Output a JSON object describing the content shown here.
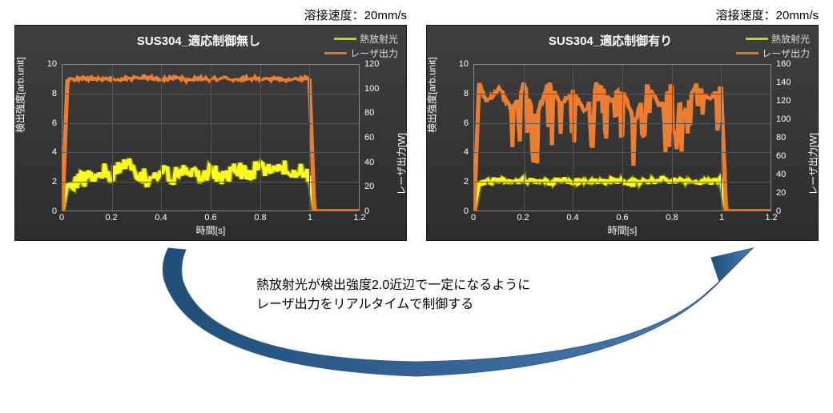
{
  "speed_label_left": "溶接速度：20mm/s",
  "speed_label_right": "溶接速度：20mm/s",
  "legend_thermal": "熱放射光",
  "legend_laser": "レーザ出力",
  "left_chart": {
    "title": "SUS304_適応制御無し",
    "xlabel": "時間[s]",
    "ylabel_left": "検出強度[arb.unit]",
    "ylabel_right": "レーザ出力[W]",
    "xticks": [
      "0",
      "0.2",
      "0.4",
      "0.6",
      "0.8",
      "1",
      "1.2"
    ],
    "yticks_left": [
      "0",
      "2",
      "4",
      "6",
      "8",
      "10"
    ],
    "yticks_right": [
      "0",
      "20",
      "40",
      "60",
      "80",
      "100",
      "120"
    ]
  },
  "right_chart": {
    "title": "SUS304_適応制御有り",
    "xlabel": "時間[s]",
    "ylabel_left": "検出強度[arb.unit]",
    "ylabel_right": "レーザ出力[W]",
    "xticks": [
      "0",
      "0.2",
      "0.4",
      "0.6",
      "0.8",
      "1",
      "1.2"
    ],
    "yticks_left": [
      "0",
      "2",
      "4",
      "6",
      "8",
      "10"
    ],
    "yticks_right": [
      "0",
      "20",
      "40",
      "60",
      "80",
      "100",
      "120",
      "140",
      "160"
    ]
  },
  "caption_line1": "熱放射光が検出強度2.0近辺で一定になるように",
  "caption_line2": "レーザ出力をリアルタイムで制御する",
  "chart_data": [
    {
      "type": "line",
      "title": "SUS304_適応制御無し",
      "xlabel": "時間[s]",
      "ylabel_left": "検出強度[arb.unit]",
      "ylabel_right": "レーザ出力[W]",
      "xlim": [
        0,
        1.2
      ],
      "ylim_left": [
        0,
        10
      ],
      "ylim_right": [
        0,
        120
      ],
      "x": [
        0,
        0.02,
        0.05,
        0.1,
        0.15,
        0.2,
        0.25,
        0.3,
        0.35,
        0.4,
        0.45,
        0.5,
        0.55,
        0.6,
        0.65,
        0.7,
        0.75,
        0.8,
        0.85,
        0.9,
        0.95,
        1.0,
        1.02,
        1.2
      ],
      "series": [
        {
          "name": "熱放射光",
          "axis": "left",
          "values": [
            0,
            1.8,
            2.0,
            2.2,
            2.8,
            2.4,
            3.4,
            2.5,
            2.2,
            2.6,
            2.3,
            2.9,
            2.4,
            2.7,
            2.3,
            2.8,
            2.5,
            3.1,
            2.6,
            3.0,
            2.7,
            2.4,
            0,
            0
          ]
        },
        {
          "name": "レーザ出力",
          "axis": "right",
          "values": [
            0,
            108,
            108,
            109,
            108,
            109,
            108,
            109,
            109,
            108,
            109,
            108,
            109,
            108,
            109,
            108,
            109,
            108,
            109,
            108,
            109,
            108,
            0,
            0
          ]
        }
      ]
    },
    {
      "type": "line",
      "title": "SUS304_適応制御有り",
      "xlabel": "時間[s]",
      "ylabel_left": "検出強度[arb.unit]",
      "ylabel_right": "レーザ出力[W]",
      "xlim": [
        0,
        1.2
      ],
      "ylim_left": [
        0,
        10
      ],
      "ylim_right": [
        0,
        160
      ],
      "x": [
        0,
        0.02,
        0.05,
        0.1,
        0.15,
        0.2,
        0.25,
        0.3,
        0.35,
        0.4,
        0.45,
        0.5,
        0.55,
        0.6,
        0.65,
        0.7,
        0.75,
        0.8,
        0.85,
        0.9,
        0.95,
        1.0,
        1.02,
        1.2
      ],
      "series": [
        {
          "name": "熱放射光",
          "axis": "left",
          "values": [
            0,
            1.9,
            2.0,
            2.1,
            2.0,
            2.1,
            2.0,
            1.9,
            2.1,
            2.0,
            2.1,
            2.0,
            2.1,
            2.0,
            1.9,
            2.0,
            2.1,
            2.0,
            2.1,
            2.0,
            2.0,
            2.0,
            0,
            0
          ]
        },
        {
          "name": "レーザ出力",
          "axis": "right",
          "values": [
            0,
            140,
            120,
            135,
            110,
            138,
            100,
            140,
            118,
            130,
            108,
            142,
            120,
            136,
            95,
            140,
            115,
            138,
            105,
            140,
            120,
            135,
            0,
            0
          ]
        }
      ]
    }
  ]
}
